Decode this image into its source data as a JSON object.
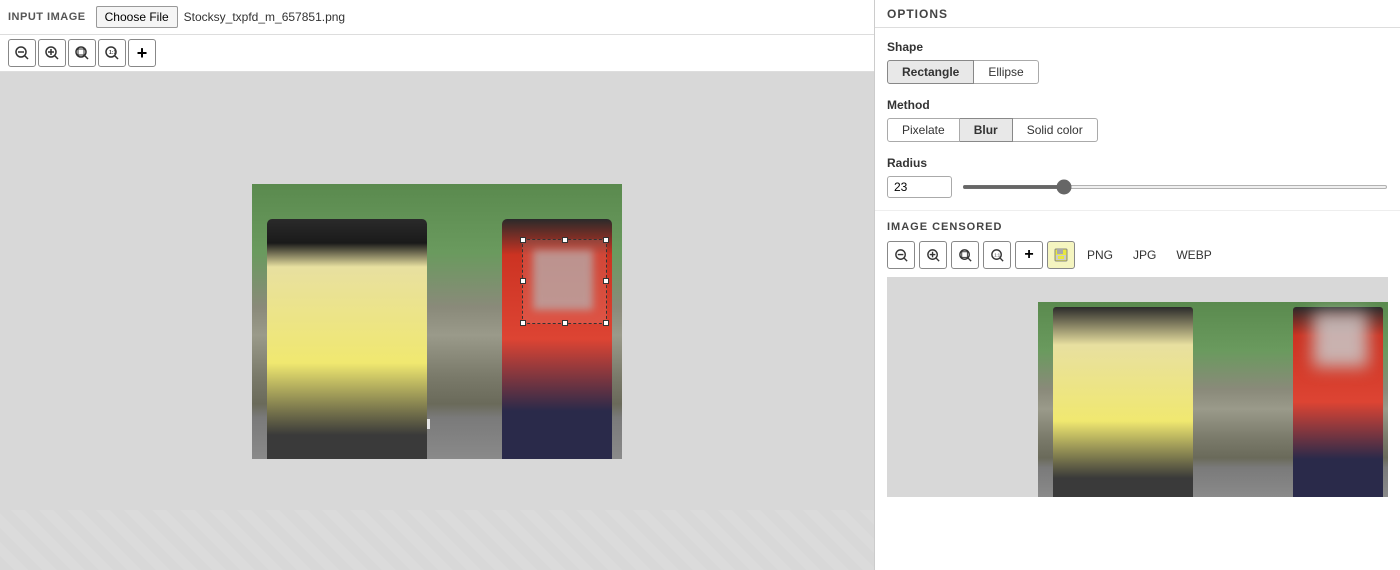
{
  "left": {
    "section_label": "INPUT IMAGE",
    "choose_file_label": "Choose File",
    "file_name": "Stocksy_txpfd_m_657851.png",
    "zoom_buttons": [
      {
        "icon": "🔍-",
        "label": "zoom-out",
        "symbol": "⊖"
      },
      {
        "icon": "🔍+",
        "label": "zoom-in",
        "symbol": "⊕"
      },
      {
        "icon": "🔍fit",
        "label": "zoom-fit",
        "symbol": "⊙"
      },
      {
        "icon": "🔍100",
        "label": "zoom-100",
        "symbol": "⊛"
      },
      {
        "icon": "+",
        "label": "add",
        "symbol": "+"
      }
    ]
  },
  "right": {
    "options_title": "OPTIONS",
    "shape_label": "Shape",
    "shape_buttons": [
      {
        "label": "Rectangle",
        "active": true
      },
      {
        "label": "Ellipse",
        "active": false
      }
    ],
    "method_label": "Method",
    "method_buttons": [
      {
        "label": "Pixelate",
        "active": false
      },
      {
        "label": "Blur",
        "active": true
      },
      {
        "label": "Solid color",
        "active": false
      }
    ],
    "radius_label": "Radius",
    "radius_value": "23",
    "radius_min": 0,
    "radius_max": 100,
    "radius_current": 23,
    "image_censored_title": "IMAGE CENSORED",
    "format_buttons": [
      "PNG",
      "JPG",
      "WEBP"
    ]
  }
}
